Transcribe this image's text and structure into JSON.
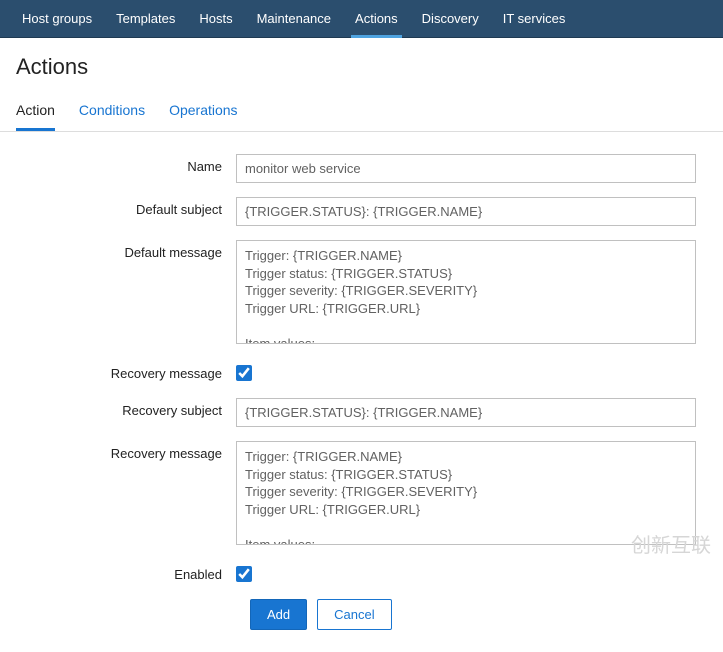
{
  "topnav": {
    "items": [
      {
        "label": "Host groups"
      },
      {
        "label": "Templates"
      },
      {
        "label": "Hosts"
      },
      {
        "label": "Maintenance"
      },
      {
        "label": "Actions",
        "active": true
      },
      {
        "label": "Discovery"
      },
      {
        "label": "IT services"
      }
    ]
  },
  "page_title": "Actions",
  "tabs": {
    "items": [
      {
        "label": "Action",
        "active": true
      },
      {
        "label": "Conditions"
      },
      {
        "label": "Operations"
      }
    ]
  },
  "form": {
    "name_label": "Name",
    "name_value": "monitor web service",
    "default_subject_label": "Default subject",
    "default_subject_value": "{TRIGGER.STATUS}: {TRIGGER.NAME}",
    "default_message_label": "Default message",
    "default_message_value": "Trigger: {TRIGGER.NAME}\nTrigger status: {TRIGGER.STATUS}\nTrigger severity: {TRIGGER.SEVERITY}\nTrigger URL: {TRIGGER.URL}\n\nItem values:\n",
    "recovery_message_chk_label": "Recovery message",
    "recovery_message_checked": true,
    "recovery_subject_label": "Recovery subject",
    "recovery_subject_value": "{TRIGGER.STATUS}: {TRIGGER.NAME}",
    "recovery_message_label": "Recovery message",
    "recovery_message_value": "Trigger: {TRIGGER.NAME}\nTrigger status: {TRIGGER.STATUS}\nTrigger severity: {TRIGGER.SEVERITY}\nTrigger URL: {TRIGGER.URL}\n\nItem values:\n",
    "enabled_label": "Enabled",
    "enabled_checked": true
  },
  "buttons": {
    "add": "Add",
    "cancel": "Cancel"
  },
  "watermark": "创新互联"
}
